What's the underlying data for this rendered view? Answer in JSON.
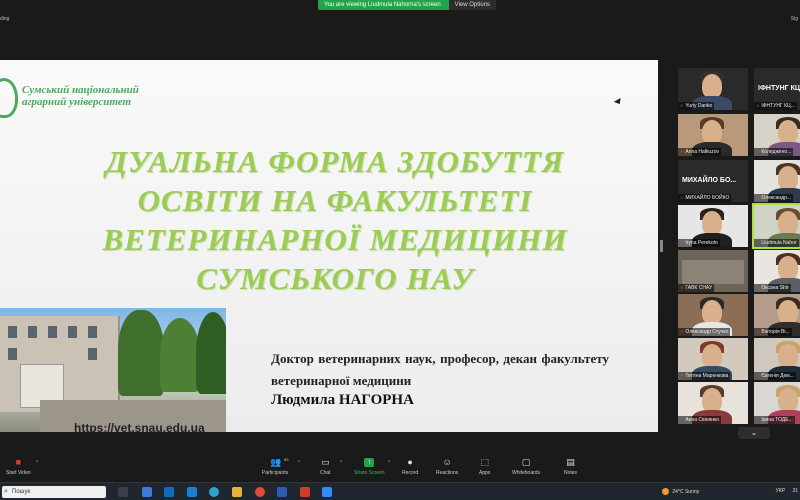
{
  "top_bar": {
    "banner": "You are viewing Liudmula Nahorna's screen",
    "view_options": "View Options",
    "recording_label": "ding",
    "sign_label": "Sig"
  },
  "slide": {
    "logo_line1": "Сумський національний",
    "logo_line2": "аграрний університет",
    "title_line1": "ДУАЛЬНА ФОРМА ЗДОБУТТЯ",
    "title_line2": "ОСВІТИ НА ФАКУЛЬТЕТІ",
    "title_line3": "ВЕТЕРИНАРНОЇ МЕДИЦИНИ",
    "title_line4": "СУМСЬКОГО НАУ",
    "presenter_desc": "Доктор ветеринарних наук, професор, декан факультету ветеринарної медицини",
    "presenter_name": "Людмила НАГОРНА",
    "url": "https://vet.snau.edu.ua",
    "title_color": "#9ccc55",
    "logo_color": "#4fa85c"
  },
  "gallery": {
    "tiles": [
      {
        "label": "Yuriy Danko",
        "big": ""
      },
      {
        "label": "ІФНТУНГ КЦ...",
        "big": "ІФНТУНГ КЦ"
      },
      {
        "label": "Anna Halkuzov",
        "big": ""
      },
      {
        "label": "Коледжено...",
        "big": ""
      },
      {
        "label": "МИХАЙЛО БОЙКО",
        "big": "МИХАЙЛО БО..."
      },
      {
        "label": "Олександр...",
        "big": ""
      },
      {
        "label": "Iryna Perekoto",
        "big": ""
      },
      {
        "label": "Liudmula Nahor",
        "big": ""
      },
      {
        "label": "ГАВК СНАУ",
        "big": ""
      },
      {
        "label": "Оксана Shir",
        "big": ""
      },
      {
        "label": "Олександр Стучко",
        "big": ""
      },
      {
        "label": "Вікторія Ві...",
        "big": ""
      },
      {
        "label": "Тетяна Маренкова",
        "big": ""
      },
      {
        "label": "Євгенія Дем...",
        "big": ""
      },
      {
        "label": "Анна Свінянко",
        "big": ""
      },
      {
        "label": "Ірина ТОДЕ...",
        "big": ""
      }
    ],
    "scroll_down": "⌄"
  },
  "toolbar": {
    "start_video": "Start Video",
    "participants": "Participants",
    "participant_count": "89",
    "chat": "Chat",
    "share_screen": "Share Screen",
    "record": "Record",
    "reactions": "Reactions",
    "apps": "Apps",
    "whiteboards": "Whiteboards",
    "notes": "Notes"
  },
  "taskbar": {
    "search_placeholder": "Пошук",
    "weather": "24°C  Sunny",
    "language": "УКР",
    "clock": "31"
  }
}
